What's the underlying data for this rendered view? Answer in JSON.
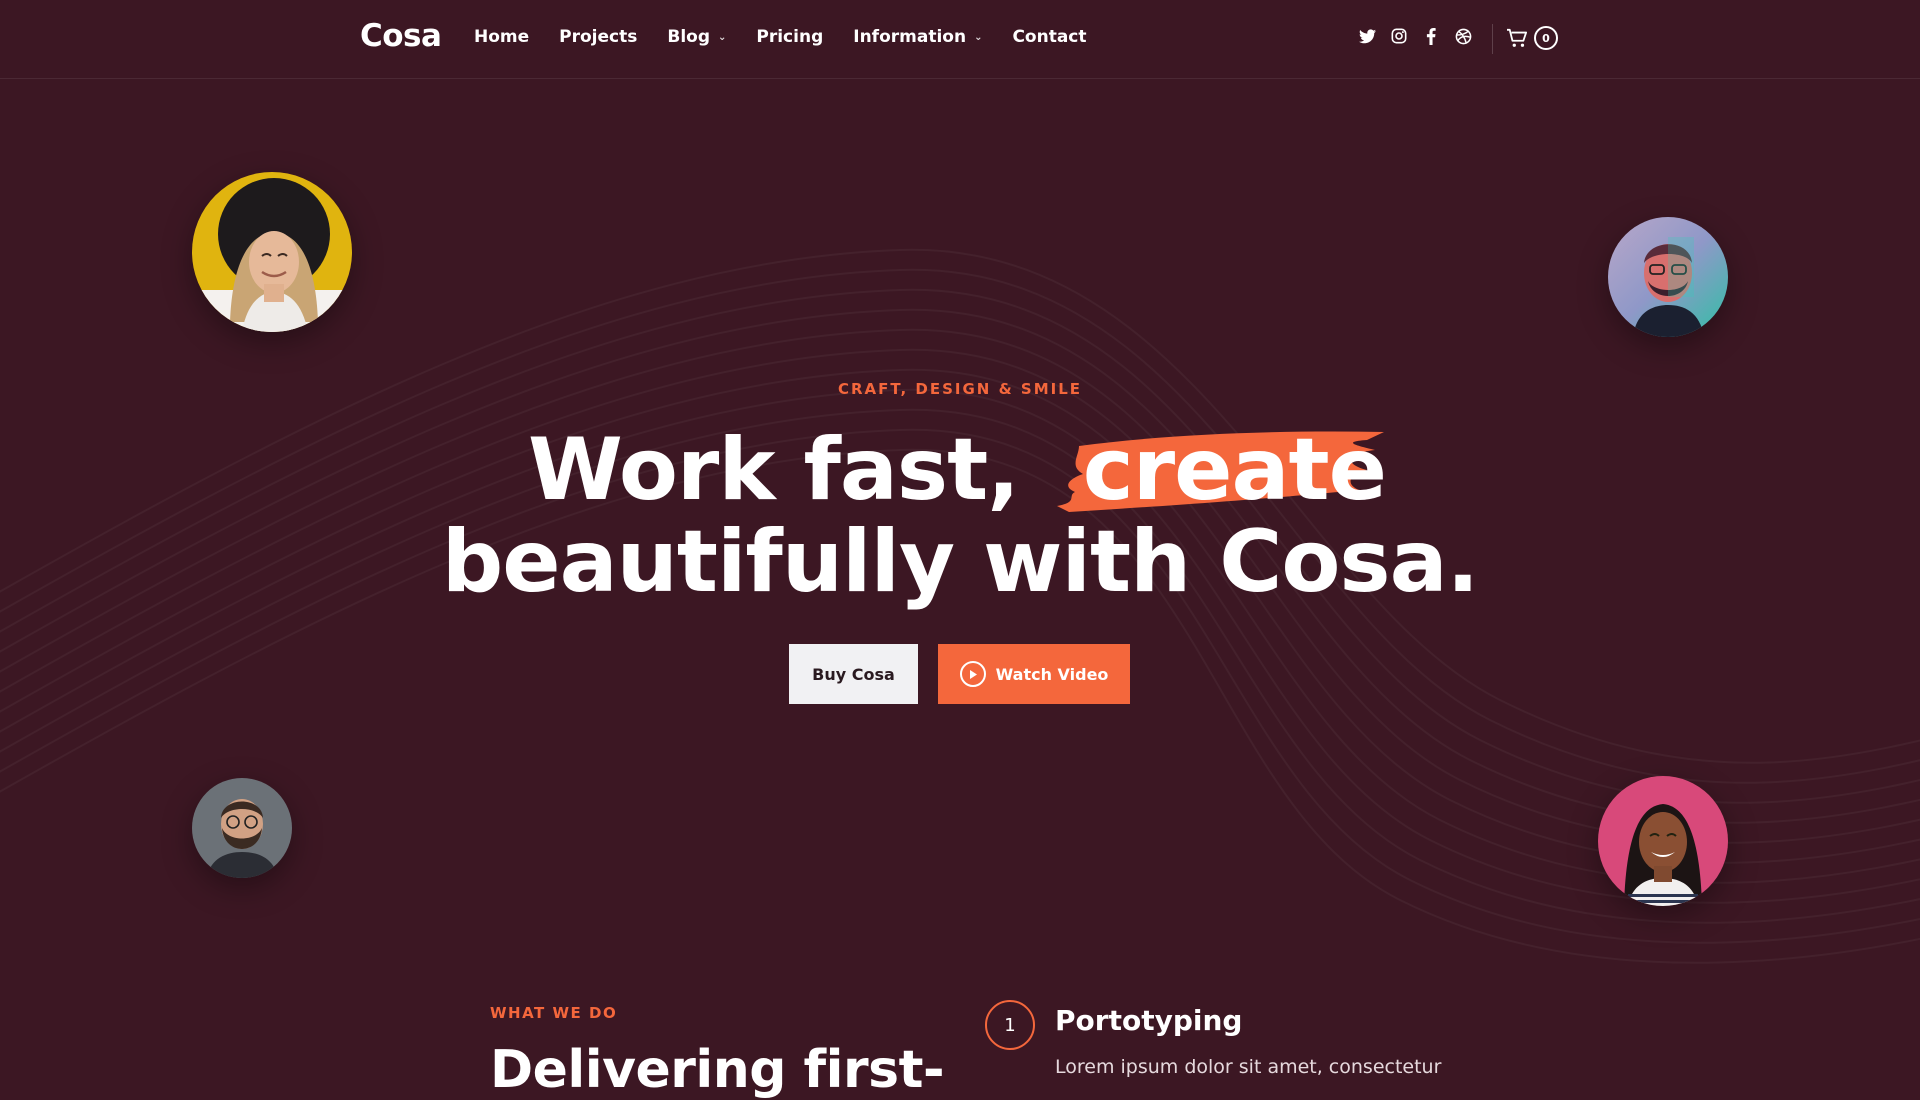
{
  "header": {
    "logo": "Cosa",
    "nav": [
      {
        "label": "Home"
      },
      {
        "label": "Projects"
      },
      {
        "label": "Blog"
      },
      {
        "label": "Pricing"
      },
      {
        "label": "Information"
      },
      {
        "label": "Contact"
      }
    ],
    "social_icons": [
      "twitter-icon",
      "instagram-icon",
      "facebook-icon",
      "dribbble-icon"
    ],
    "cart_count": "0"
  },
  "hero": {
    "eyebrow": "CRAFT, DESIGN & SMILE",
    "headline_part1": "Work fast,",
    "headline_highlight": "create",
    "headline_line2": "beautifully with Cosa.",
    "buy_button": "Buy Cosa",
    "watch_button": "Watch Video"
  },
  "what_we_do": {
    "eyebrow": "WHAT WE DO",
    "heading": "Delivering first-",
    "step_number": "1",
    "step_title": "Portotyping",
    "step_text": "Lorem ipsum dolor sit amet, consectetur"
  },
  "colors": {
    "background": "#3c1723",
    "accent": "#f4673c",
    "light_button": "#f1f1f3"
  }
}
